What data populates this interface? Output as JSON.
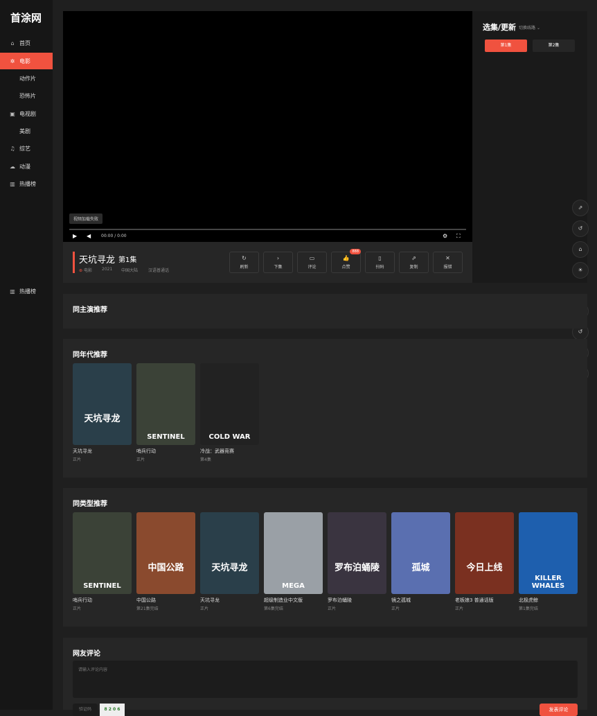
{
  "site": {
    "logo": "首涂网"
  },
  "nav": [
    {
      "label": "首页",
      "icon": "home-icon",
      "glyph": "⌂"
    },
    {
      "label": "电影",
      "icon": "film-icon",
      "glyph": "✲",
      "active": true
    },
    {
      "label": "动作片",
      "sub": true
    },
    {
      "label": "恐怖片",
      "sub": true
    },
    {
      "label": "电视剧",
      "icon": "tv-icon",
      "glyph": "▣"
    },
    {
      "label": "美剧",
      "sub": true
    },
    {
      "label": "综艺",
      "icon": "music-icon",
      "glyph": "♫"
    },
    {
      "label": "动漫",
      "icon": "cloud-icon",
      "glyph": "☁"
    },
    {
      "label": "热播榜",
      "icon": "chart-icon",
      "glyph": "▥"
    }
  ],
  "nav_footer": {
    "label": "热播榜",
    "glyph": "▥"
  },
  "player": {
    "error": "视频加载失败",
    "time": "00:00 / 0:00"
  },
  "video": {
    "title": "天坑寻龙",
    "episode": "第1集",
    "meta": [
      "电影",
      "2021",
      "中国大陆",
      "汉语普通话"
    ]
  },
  "actions": [
    {
      "label": "刷新",
      "icon": "refresh-icon",
      "glyph": "↻"
    },
    {
      "label": "下集",
      "icon": "next-icon",
      "glyph": "›"
    },
    {
      "label": "评论",
      "icon": "comment-icon",
      "glyph": "▭"
    },
    {
      "label": "点赞",
      "icon": "thumbs-up-icon",
      "glyph": "👍",
      "badge": "888"
    },
    {
      "label": "扫码",
      "icon": "phone-icon",
      "glyph": "▯"
    },
    {
      "label": "复制",
      "icon": "share-icon",
      "glyph": "⇗"
    },
    {
      "label": "报错",
      "icon": "close-icon",
      "glyph": "✕"
    }
  ],
  "episodes": {
    "title": "选集/更新",
    "switch": "切换线路",
    "items": [
      "第1集",
      "第2集"
    ]
  },
  "sections": {
    "actor": {
      "title": "同主演推荐"
    },
    "year": {
      "title": "同年代推荐",
      "items": [
        {
          "name": "天坑寻龙",
          "sub": "正片",
          "poster_text": "天坑寻龙",
          "bg": "#2a3f4a"
        },
        {
          "name": "哨兵行动",
          "sub": "正片",
          "poster_text": "SENTINEL",
          "bg": "#3b4237"
        },
        {
          "name": "冷战：武器竞赛",
          "sub": "第4集",
          "poster_text": "COLD WAR",
          "bg": "#222222"
        }
      ]
    },
    "genre": {
      "title": "同类型推荐",
      "items": [
        {
          "name": "哨兵行动",
          "sub": "正片",
          "poster_text": "SENTINEL",
          "bg": "#3b4237"
        },
        {
          "name": "中国公路",
          "sub": "第21集完结",
          "poster_text": "中国公路",
          "bg": "#8a4a2e"
        },
        {
          "name": "天坑寻龙",
          "sub": "正片",
          "poster_text": "天坑寻龙",
          "bg": "#2a3f4a"
        },
        {
          "name": "超级制造业中文版",
          "sub": "第6集完结",
          "poster_text": "MEGA",
          "bg": "#9aa0a6"
        },
        {
          "name": "罗布泊蛹陵",
          "sub": "正片",
          "poster_text": "罗布泊蛹陵",
          "bg": "#3a3440"
        },
        {
          "name": "镜之孤城",
          "sub": "正片",
          "poster_text": "孤城",
          "bg": "#5a6fb0"
        },
        {
          "name": "老板娘3 普通话版",
          "sub": "正片",
          "poster_text": "今日上线",
          "bg": "#7a3020"
        },
        {
          "name": "北极虎鲸",
          "sub": "第1集完结",
          "poster_text": "KILLER WHALES",
          "bg": "#1e5fae"
        }
      ]
    },
    "comments": {
      "title": "网友评论",
      "placeholder": "请输入评论内容",
      "captcha_placeholder": "验证码",
      "captcha_image": "8 2 0 6",
      "submit": "发表评论"
    }
  },
  "float_buttons": [
    {
      "icon": "share-icon",
      "glyph": "⇗"
    },
    {
      "icon": "refresh-icon",
      "glyph": "↺"
    },
    {
      "icon": "home-icon",
      "glyph": "⌂"
    },
    {
      "icon": "sun-icon",
      "glyph": "☀"
    }
  ],
  "colors": {
    "accent": "#f0523f",
    "bg": "#1f1f1f",
    "panel": "#262626"
  }
}
